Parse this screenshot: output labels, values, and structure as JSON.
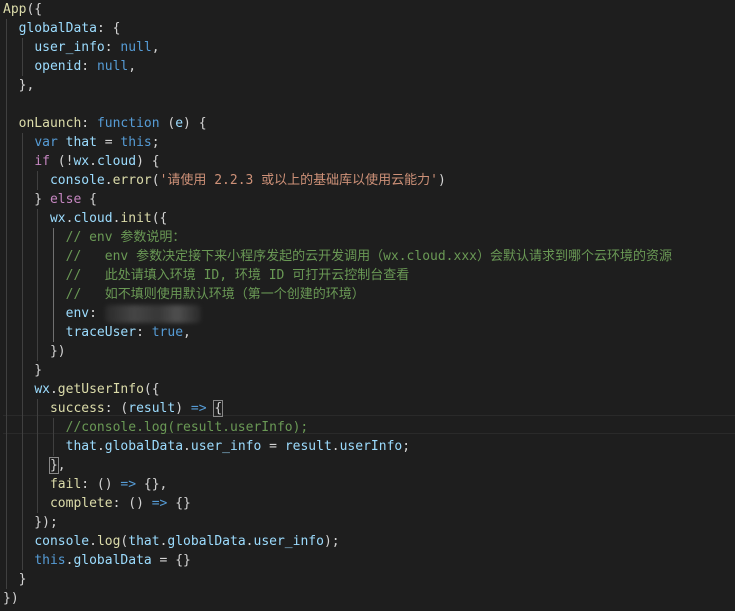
{
  "editor": {
    "lines": [
      [
        {
          "t": "App",
          "c": "t-fn"
        },
        {
          "t": "({",
          "c": "t-punc"
        }
      ],
      [
        {
          "t": "  ",
          "c": "t-punc"
        },
        {
          "t": "globalData",
          "c": "t-key"
        },
        {
          "t": ": {",
          "c": "t-punc"
        }
      ],
      [
        {
          "t": "    ",
          "c": "t-punc"
        },
        {
          "t": "user_info",
          "c": "t-key"
        },
        {
          "t": ": ",
          "c": "t-punc"
        },
        {
          "t": "null",
          "c": "t-kw"
        },
        {
          "t": ",",
          "c": "t-punc"
        }
      ],
      [
        {
          "t": "    ",
          "c": "t-punc"
        },
        {
          "t": "openid",
          "c": "t-key"
        },
        {
          "t": ": ",
          "c": "t-punc"
        },
        {
          "t": "null",
          "c": "t-kw"
        },
        {
          "t": ",",
          "c": "t-punc"
        }
      ],
      [
        {
          "t": "  },",
          "c": "t-punc"
        }
      ],
      [
        {
          "t": "",
          "c": "t-punc"
        }
      ],
      [
        {
          "t": "  ",
          "c": "t-punc"
        },
        {
          "t": "onLaunch",
          "c": "t-fn"
        },
        {
          "t": ": ",
          "c": "t-punc"
        },
        {
          "t": "function",
          "c": "t-kw"
        },
        {
          "t": " (",
          "c": "t-punc"
        },
        {
          "t": "e",
          "c": "t-var"
        },
        {
          "t": ") {",
          "c": "t-punc"
        }
      ],
      [
        {
          "t": "    ",
          "c": "t-punc"
        },
        {
          "t": "var",
          "c": "t-kw"
        },
        {
          "t": " ",
          "c": "t-punc"
        },
        {
          "t": "that",
          "c": "t-var"
        },
        {
          "t": " = ",
          "c": "t-punc"
        },
        {
          "t": "this",
          "c": "t-kw"
        },
        {
          "t": ";",
          "c": "t-punc"
        }
      ],
      [
        {
          "t": "    ",
          "c": "t-punc"
        },
        {
          "t": "if",
          "c": "t-ctrl"
        },
        {
          "t": " (!",
          "c": "t-punc"
        },
        {
          "t": "wx",
          "c": "t-var"
        },
        {
          "t": ".",
          "c": "t-punc"
        },
        {
          "t": "cloud",
          "c": "t-var"
        },
        {
          "t": ") {",
          "c": "t-punc"
        }
      ],
      [
        {
          "t": "      ",
          "c": "t-punc"
        },
        {
          "t": "console",
          "c": "t-var"
        },
        {
          "t": ".",
          "c": "t-punc"
        },
        {
          "t": "error",
          "c": "t-fn"
        },
        {
          "t": "(",
          "c": "t-punc"
        },
        {
          "t": "'请使用 2.2.3 或以上的基础库以使用云能力'",
          "c": "t-str"
        },
        {
          "t": ")",
          "c": "t-punc"
        }
      ],
      [
        {
          "t": "    } ",
          "c": "t-punc"
        },
        {
          "t": "else",
          "c": "t-ctrl"
        },
        {
          "t": " {",
          "c": "t-punc"
        }
      ],
      [
        {
          "t": "      ",
          "c": "t-punc"
        },
        {
          "t": "wx",
          "c": "t-var"
        },
        {
          "t": ".",
          "c": "t-punc"
        },
        {
          "t": "cloud",
          "c": "t-var"
        },
        {
          "t": ".",
          "c": "t-punc"
        },
        {
          "t": "init",
          "c": "t-fn"
        },
        {
          "t": "({",
          "c": "t-punc"
        }
      ],
      [
        {
          "t": "        ",
          "c": "t-punc"
        },
        {
          "t": "// env 参数说明：",
          "c": "t-cmt"
        }
      ],
      [
        {
          "t": "        ",
          "c": "t-punc"
        },
        {
          "t": "//   env 参数决定接下来小程序发起的云开发调用（wx.cloud.xxx）会默认请求到哪个云环境的资源",
          "c": "t-cmt"
        }
      ],
      [
        {
          "t": "        ",
          "c": "t-punc"
        },
        {
          "t": "//   此处请填入环境 ID, 环境 ID 可打开云控制台查看",
          "c": "t-cmt"
        }
      ],
      [
        {
          "t": "        ",
          "c": "t-punc"
        },
        {
          "t": "//   如不填则使用默认环境（第一个创建的环境）",
          "c": "t-cmt"
        }
      ],
      [
        {
          "t": "        ",
          "c": "t-punc"
        },
        {
          "t": "env",
          "c": "t-key"
        },
        {
          "t": ": ",
          "c": "t-punc"
        },
        {
          "t": "__BLUR__",
          "c": "blur"
        }
      ],
      [
        {
          "t": "        ",
          "c": "t-punc"
        },
        {
          "t": "traceUser",
          "c": "t-key"
        },
        {
          "t": ": ",
          "c": "t-punc"
        },
        {
          "t": "true",
          "c": "t-bool"
        },
        {
          "t": ",",
          "c": "t-punc"
        }
      ],
      [
        {
          "t": "      })",
          "c": "t-punc"
        }
      ],
      [
        {
          "t": "    }",
          "c": "t-punc"
        }
      ],
      [
        {
          "t": "    ",
          "c": "t-punc"
        },
        {
          "t": "wx",
          "c": "t-var"
        },
        {
          "t": ".",
          "c": "t-punc"
        },
        {
          "t": "getUserInfo",
          "c": "t-fn"
        },
        {
          "t": "({",
          "c": "t-punc"
        }
      ],
      [
        {
          "t": "      ",
          "c": "t-punc"
        },
        {
          "t": "success",
          "c": "t-fn"
        },
        {
          "t": ": (",
          "c": "t-punc"
        },
        {
          "t": "result",
          "c": "t-var"
        },
        {
          "t": ") ",
          "c": "t-punc"
        },
        {
          "t": "=>",
          "c": "t-kw"
        },
        {
          "t": " ",
          "c": "t-punc"
        },
        {
          "t": "{",
          "c": "t-punc bracket-hl"
        }
      ],
      [
        {
          "t": "        ",
          "c": "t-punc"
        },
        {
          "t": "//console.log(result.userInfo);",
          "c": "t-cmt"
        }
      ],
      [
        {
          "t": "        ",
          "c": "t-punc"
        },
        {
          "t": "that",
          "c": "t-var"
        },
        {
          "t": ".",
          "c": "t-punc"
        },
        {
          "t": "globalData",
          "c": "t-var"
        },
        {
          "t": ".",
          "c": "t-punc"
        },
        {
          "t": "user_info",
          "c": "t-var"
        },
        {
          "t": " = ",
          "c": "t-punc"
        },
        {
          "t": "result",
          "c": "t-var"
        },
        {
          "t": ".",
          "c": "t-punc"
        },
        {
          "t": "userInfo",
          "c": "t-var"
        },
        {
          "t": ";",
          "c": "t-punc"
        }
      ],
      [
        {
          "t": "      ",
          "c": "t-punc"
        },
        {
          "t": "}",
          "c": "t-punc bracket-hl"
        },
        {
          "t": ",",
          "c": "t-punc"
        }
      ],
      [
        {
          "t": "      ",
          "c": "t-punc"
        },
        {
          "t": "fail",
          "c": "t-fn"
        },
        {
          "t": ": () ",
          "c": "t-punc"
        },
        {
          "t": "=>",
          "c": "t-kw"
        },
        {
          "t": " {},",
          "c": "t-punc"
        }
      ],
      [
        {
          "t": "      ",
          "c": "t-punc"
        },
        {
          "t": "complete",
          "c": "t-fn"
        },
        {
          "t": ": () ",
          "c": "t-punc"
        },
        {
          "t": "=>",
          "c": "t-kw"
        },
        {
          "t": " {}",
          "c": "t-punc"
        }
      ],
      [
        {
          "t": "    });",
          "c": "t-punc"
        }
      ],
      [
        {
          "t": "    ",
          "c": "t-punc"
        },
        {
          "t": "console",
          "c": "t-var"
        },
        {
          "t": ".",
          "c": "t-punc"
        },
        {
          "t": "log",
          "c": "t-fn"
        },
        {
          "t": "(",
          "c": "t-punc"
        },
        {
          "t": "that",
          "c": "t-var"
        },
        {
          "t": ".",
          "c": "t-punc"
        },
        {
          "t": "globalData",
          "c": "t-var"
        },
        {
          "t": ".",
          "c": "t-punc"
        },
        {
          "t": "user_info",
          "c": "t-var"
        },
        {
          "t": ");",
          "c": "t-punc"
        }
      ],
      [
        {
          "t": "    ",
          "c": "t-punc"
        },
        {
          "t": "this",
          "c": "t-kw"
        },
        {
          "t": ".",
          "c": "t-punc"
        },
        {
          "t": "globalData",
          "c": "t-var"
        },
        {
          "t": " = {}",
          "c": "t-punc"
        }
      ],
      [
        {
          "t": "  }",
          "c": "t-punc"
        }
      ],
      [
        {
          "t": "})",
          "c": "t-punc"
        }
      ]
    ]
  }
}
